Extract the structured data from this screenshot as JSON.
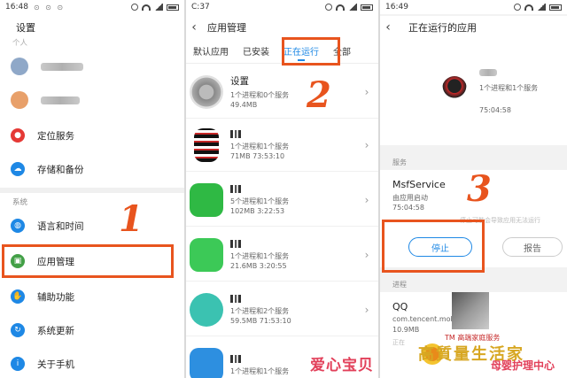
{
  "screen1": {
    "status": {
      "time": "16:48",
      "dots": "⊙ ⊙ ⊙"
    },
    "title": "设置",
    "truncated_header": "个人",
    "section_system": "系统",
    "items": [
      {
        "label": "定位服务",
        "icon": "location-icon",
        "color": "#e53935"
      },
      {
        "label": "存储和备份",
        "icon": "cloud-icon",
        "color": "#1e88e5"
      },
      {
        "label": "语言和时间",
        "icon": "globe-icon",
        "color": "#1e88e5"
      },
      {
        "label": "应用管理",
        "icon": "apps-icon",
        "color": "#43a047"
      },
      {
        "label": "辅助功能",
        "icon": "accessibility-icon",
        "color": "#1e88e5"
      },
      {
        "label": "系统更新",
        "icon": "update-icon",
        "color": "#1e88e5"
      },
      {
        "label": "关于手机",
        "icon": "info-icon",
        "color": "#1e88e5"
      }
    ]
  },
  "screen2": {
    "status": {
      "time": "C:37"
    },
    "title": "应用管理",
    "tabs": [
      "默认应用",
      "已安装",
      "正在运行",
      "全部"
    ],
    "active_tab": "正在运行",
    "apps": [
      {
        "name": "设置",
        "sub1": "1个进程和0个服务",
        "sub2": "49.4MB"
      },
      {
        "name": "",
        "sub1": "1个进程和1个服务",
        "sub2": "71MB   73:53:10"
      },
      {
        "name": "",
        "sub1": "5个进程和1个服务",
        "sub2": "102MB   3:22:53"
      },
      {
        "name": "",
        "sub1": "1个进程和1个服务",
        "sub2": "21.6MB   3:20:55"
      },
      {
        "name": "",
        "sub1": "1个进程和2个服务",
        "sub2": "59.5MB   71:53:10"
      },
      {
        "name": "",
        "sub1": "1个进程和1个服务",
        "sub2": ""
      }
    ]
  },
  "screen3": {
    "status": {
      "time": "16:49"
    },
    "title": "正在运行的应用",
    "head_sub": "1个进程和1个服务",
    "head_time": "75:04:58",
    "section_service": "服务",
    "service_name": "MsfService",
    "service_sub": "由应用启动",
    "service_time": "75:04:58",
    "service_warn": "停止可能会导致应用无法运行",
    "stop_button": "停止",
    "report_button": "报告",
    "section_process": "进程",
    "process_name": "QQ",
    "process_pkg": "com.tencent.mobileqq:MSF",
    "process_mem": "10.9MB",
    "process_note": "正在"
  },
  "steps": [
    "1",
    "2",
    "3"
  ],
  "watermark": {
    "text": "爱心宝贝",
    "brand": "高質量生活家",
    "tm": "TM 高端家庭服务",
    "slogan": "母婴护理中心"
  },
  "colors": {
    "accent": "#1e88e5",
    "annotation": "#e8541e",
    "watermark": "#e2405a"
  }
}
